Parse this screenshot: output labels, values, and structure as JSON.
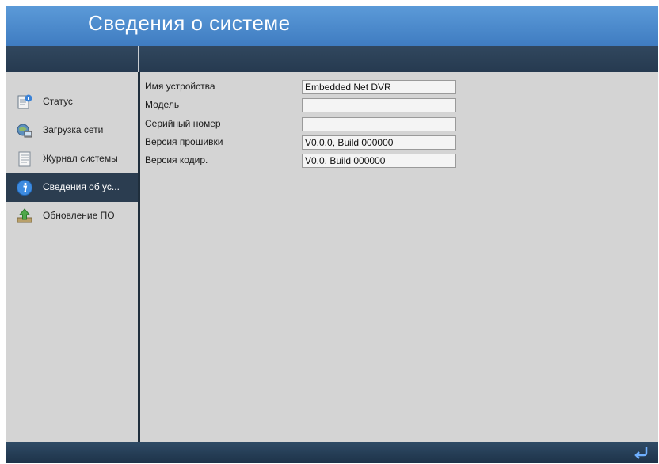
{
  "window": {
    "title": "Сведения о системе"
  },
  "sidebar": {
    "items": [
      {
        "label": "Статус",
        "icon": "status-document-icon",
        "active": false
      },
      {
        "label": "Загрузка сети",
        "icon": "network-globe-icon",
        "active": false
      },
      {
        "label": "Журнал системы",
        "icon": "log-document-icon",
        "active": false
      },
      {
        "label": "Сведения об ус...",
        "icon": "info-icon",
        "active": true
      },
      {
        "label": "Обновление ПО",
        "icon": "upgrade-arrow-icon",
        "active": false
      }
    ]
  },
  "info": {
    "fields": [
      {
        "label": "Имя устройства",
        "value": "Embedded Net DVR"
      },
      {
        "label": "Модель",
        "value": ""
      },
      {
        "label": "Серийный номер",
        "value": ""
      },
      {
        "label": "Версия прошивки",
        "value": "V0.0.0, Build 000000"
      },
      {
        "label": "Версия кодир.",
        "value": "V0.0, Build 000000"
      }
    ]
  },
  "colors": {
    "title_bar": "#4a8bd0",
    "dark_bar": "#2b3d50",
    "panel": "#d4d4d4",
    "active_item": "#2b3d50"
  },
  "footer": {
    "back_icon": "return-arrow-icon"
  }
}
